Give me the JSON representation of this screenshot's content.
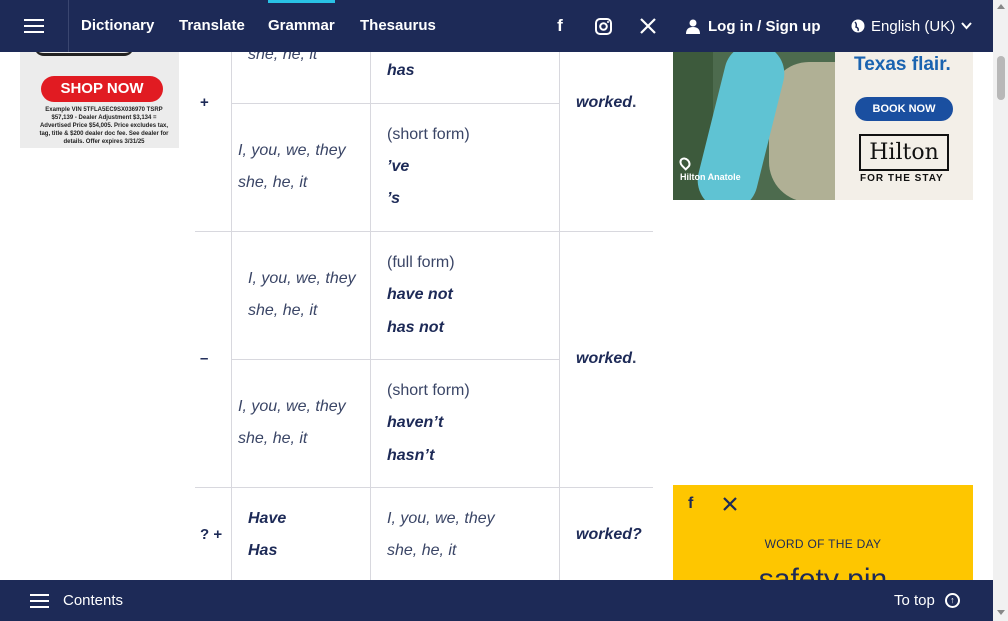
{
  "nav": {
    "links": [
      "Dictionary",
      "Translate",
      "Grammar",
      "Thesaurus"
    ],
    "active": "Grammar",
    "login_label": "Log in / Sign up",
    "language_label": "English (UK)",
    "icons": [
      "menu-icon",
      "facebook-icon",
      "instagram-icon",
      "x-icon",
      "user-icon",
      "globe-icon",
      "chevron-down-icon"
    ]
  },
  "left_ad": {
    "button": "SHOP NOW",
    "fine_print": "Example VIN 5TFLA5EC9SX036970 TSRP $57,139 - Dealer Adjustment $3,134 = Advertised Price $54,005. Price excludes tax, tag, title & $200 dealer doc fee. See dealer for details. Offer expires 3/31/25"
  },
  "table": {
    "positive": {
      "sign": "+",
      "full_pronouns_partial": "she, he, it",
      "full_aux_partial": "has",
      "short_pronouns": [
        "I, you, we, they",
        "she, he, it"
      ],
      "short_label": "(short form)",
      "short_aux": [
        "’ve",
        "’s"
      ],
      "verb": "worked",
      "punct": "."
    },
    "negative": {
      "sign": "–",
      "full_pronouns": [
        "I, you, we, they",
        "she, he, it"
      ],
      "full_label": "(full form)",
      "full_aux": [
        "have not",
        "has not"
      ],
      "short_pronouns": [
        "I, you, we, they",
        "she, he, it"
      ],
      "short_label": "(short form)",
      "short_aux": [
        "haven’t",
        "hasn’t"
      ],
      "verb": "worked",
      "punct": "."
    },
    "question": {
      "sign": "? +",
      "aux": [
        "Have",
        "Has"
      ],
      "pronouns": [
        "I, you, we, they",
        "she, he, it"
      ],
      "verb": "worked?"
    }
  },
  "right_ad": {
    "headline": "Texas flair.",
    "location": "Hilton Anatole",
    "button": "BOOK NOW",
    "brand": "Hilton",
    "tagline": "FOR THE STAY"
  },
  "wotd": {
    "label": "WORD OF THE DAY",
    "word": "safety pin"
  },
  "bottom": {
    "contents_label": "Contents",
    "totop_label": "To top"
  }
}
